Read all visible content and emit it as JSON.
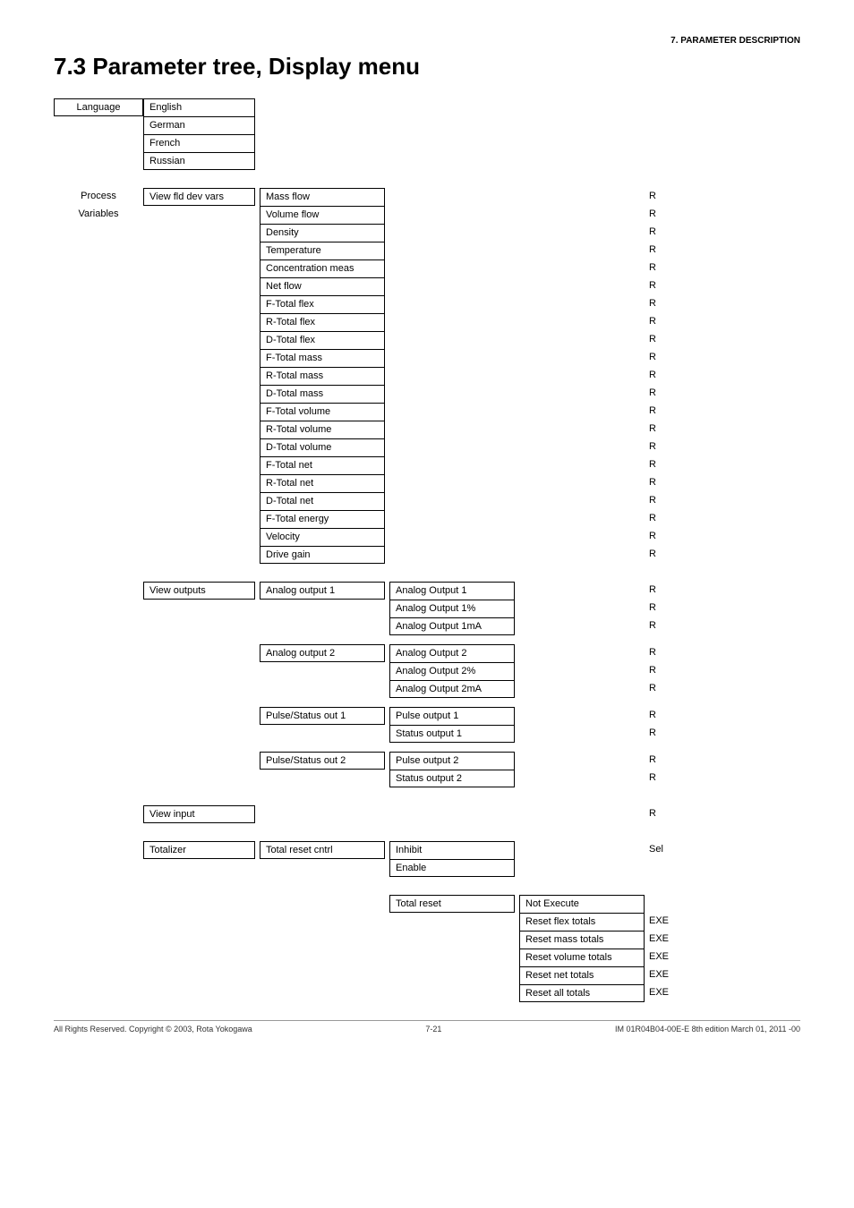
{
  "header": {
    "section": "7.  PARAMETER DESCRIPTION"
  },
  "title": "7.3  Parameter tree, Display menu",
  "language": {
    "label": "Language",
    "options": [
      "English",
      "German",
      "French",
      "Russian"
    ]
  },
  "process": {
    "label1": "Process",
    "label2": "Variables",
    "viewFldDevVars": {
      "label": "View fld dev vars",
      "items": [
        "Mass flow",
        "Volume flow",
        "Density",
        "Temperature",
        "Concentration meas",
        "Net flow",
        "F-Total flex",
        "R-Total flex",
        "D-Total flex",
        "F-Total mass",
        "R-Total mass",
        "D-Total mass",
        "F-Total volume",
        "R-Total volume",
        "D-Total volume",
        "F-Total net",
        "R-Total net",
        "D-Total net",
        "F-Total energy",
        "Velocity",
        "Drive gain"
      ],
      "flags": [
        "R",
        "R",
        "R",
        "R",
        "R",
        "R",
        "R",
        "R",
        "R",
        "R",
        "R",
        "R",
        "R",
        "R",
        "R",
        "R",
        "R",
        "R",
        "R",
        "R",
        "R"
      ]
    },
    "viewOutputs": {
      "label": "View outputs",
      "analog1": {
        "label": "Analog output 1",
        "items": [
          "Analog Output 1",
          "Analog Output 1%",
          "Analog Output 1mA"
        ],
        "flags": [
          "R",
          "R",
          "R"
        ]
      },
      "analog2": {
        "label": "Analog output 2",
        "items": [
          "Analog Output 2",
          "Analog Output 2%",
          "Analog Output 2mA"
        ],
        "flags": [
          "R",
          "R",
          "R"
        ]
      },
      "pulse1": {
        "label": "Pulse/Status out 1",
        "items": [
          "Pulse output 1",
          "Status output 1"
        ],
        "flags": [
          "R",
          "R"
        ]
      },
      "pulse2": {
        "label": "Pulse/Status out 2",
        "items": [
          "Pulse output 2",
          "Status output 2"
        ],
        "flags": [
          "R",
          "R"
        ]
      }
    },
    "viewInput": {
      "label": "View input",
      "flag": "R"
    },
    "totalizer": {
      "label": "Totalizer",
      "totalResetCntrl": {
        "label": "Total reset cntrl",
        "items": [
          "Inhibit",
          "Enable"
        ],
        "flag": "Sel"
      },
      "totalReset": {
        "label": "Total reset",
        "items": [
          "Not Execute",
          "Reset flex totals",
          "Reset mass totals",
          "Reset volume totals",
          "Reset net totals",
          "Reset all totals"
        ],
        "flags": [
          "",
          "EXE",
          "EXE",
          "EXE",
          "EXE",
          "EXE"
        ]
      }
    }
  },
  "footer": {
    "left": "All Rights Reserved. Copyright © 2003, Rota Yokogawa",
    "center": "7-21",
    "right": "IM 01R04B04-00E-E  8th edition March 01, 2011 -00"
  }
}
